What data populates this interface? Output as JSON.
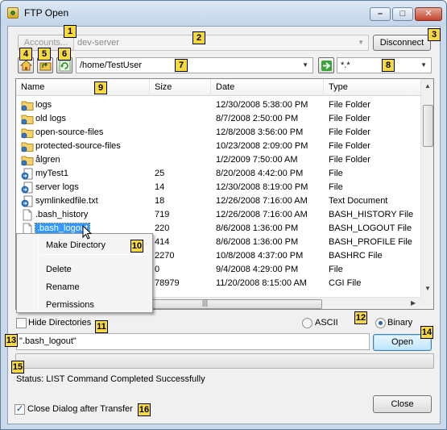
{
  "window": {
    "title": "FTP Open"
  },
  "connection": {
    "accounts_label": "Accounts...",
    "server": "dev-server",
    "disconnect_label": "Disconnect"
  },
  "path": {
    "current": "/home/TestUser",
    "filter": "*.*"
  },
  "columns": [
    "Name",
    "Size",
    "Date",
    "Type"
  ],
  "files": [
    {
      "name": "logs",
      "size": "",
      "date": "12/30/2008 5:38:00 PM",
      "type": "File Folder",
      "icon": "folder-icon"
    },
    {
      "name": "old logs",
      "size": "",
      "date": "8/7/2008 2:50:00 PM",
      "type": "File Folder",
      "icon": "folder-icon"
    },
    {
      "name": "open-source-files",
      "size": "",
      "date": "12/8/2008 3:56:00 PM",
      "type": "File Folder",
      "icon": "folder-icon"
    },
    {
      "name": "protected-source-files",
      "size": "",
      "date": "10/23/2008 2:09:00 PM",
      "type": "File Folder",
      "icon": "folder-icon"
    },
    {
      "name": "ålgren",
      "size": "",
      "date": "1/2/2009 7:50:00 AM",
      "type": "File Folder",
      "icon": "folder-icon"
    },
    {
      "name": "myTest1",
      "size": "25",
      "date": "8/20/2008 4:42:00 PM",
      "type": "File",
      "icon": "symlink-icon"
    },
    {
      "name": "server logs",
      "size": "14",
      "date": "12/30/2008 8:19:00 PM",
      "type": "File",
      "icon": "symlink-icon"
    },
    {
      "name": "symlinkedfile.txt",
      "size": "18",
      "date": "12/26/2008 7:16:00 AM",
      "type": "Text Document",
      "icon": "symlink-icon"
    },
    {
      "name": ".bash_history",
      "size": "719",
      "date": "12/26/2008 7:16:00 AM",
      "type": "BASH_HISTORY File",
      "icon": "file-icon"
    },
    {
      "name": ".bash_logout",
      "size": "220",
      "date": "8/6/2008 1:36:00 PM",
      "type": "BASH_LOGOUT File",
      "icon": "file-icon"
    },
    {
      "name": "",
      "size": "414",
      "date": "8/6/2008 1:36:00 PM",
      "type": "BASH_PROFILE File",
      "icon": "file-icon"
    },
    {
      "name": "",
      "size": "2270",
      "date": "10/8/2008 4:37:00 PM",
      "type": "BASHRC File",
      "icon": "file-icon"
    },
    {
      "name": "",
      "size": "0",
      "date": "9/4/2008 4:29:00 PM",
      "type": "File",
      "icon": "file-icon"
    },
    {
      "name": "",
      "size": "78979",
      "date": "11/20/2008 8:15:00 AM",
      "type": "CGI File",
      "icon": "file-icon"
    }
  ],
  "selected_index": 9,
  "context_menu": {
    "items": [
      "Make Directory",
      "Delete",
      "Rename",
      "Permissions"
    ]
  },
  "options": {
    "hide_directories_label": "Hide Directories",
    "hide_directories_checked": false,
    "ascii_label": "ASCII",
    "binary_label": "Binary",
    "transfer_mode": "Binary"
  },
  "filename": {
    "value": "\".bash_logout\"",
    "open_label": "Open"
  },
  "progress": {
    "fraction": 0
  },
  "status": {
    "text": "Status: LIST Command Completed Successfully"
  },
  "close_after": {
    "label": "Close Dialog after Transfer",
    "checked": true
  },
  "close_label": "Close",
  "badges": [
    "1",
    "2",
    "3",
    "4",
    "5",
    "6",
    "7",
    "8",
    "9",
    "10",
    "11",
    "12",
    "13",
    "14",
    "15",
    "16"
  ],
  "colors": {
    "badge": "#f6d940",
    "selection": "#3399ff",
    "progress": "#3cb53c"
  }
}
